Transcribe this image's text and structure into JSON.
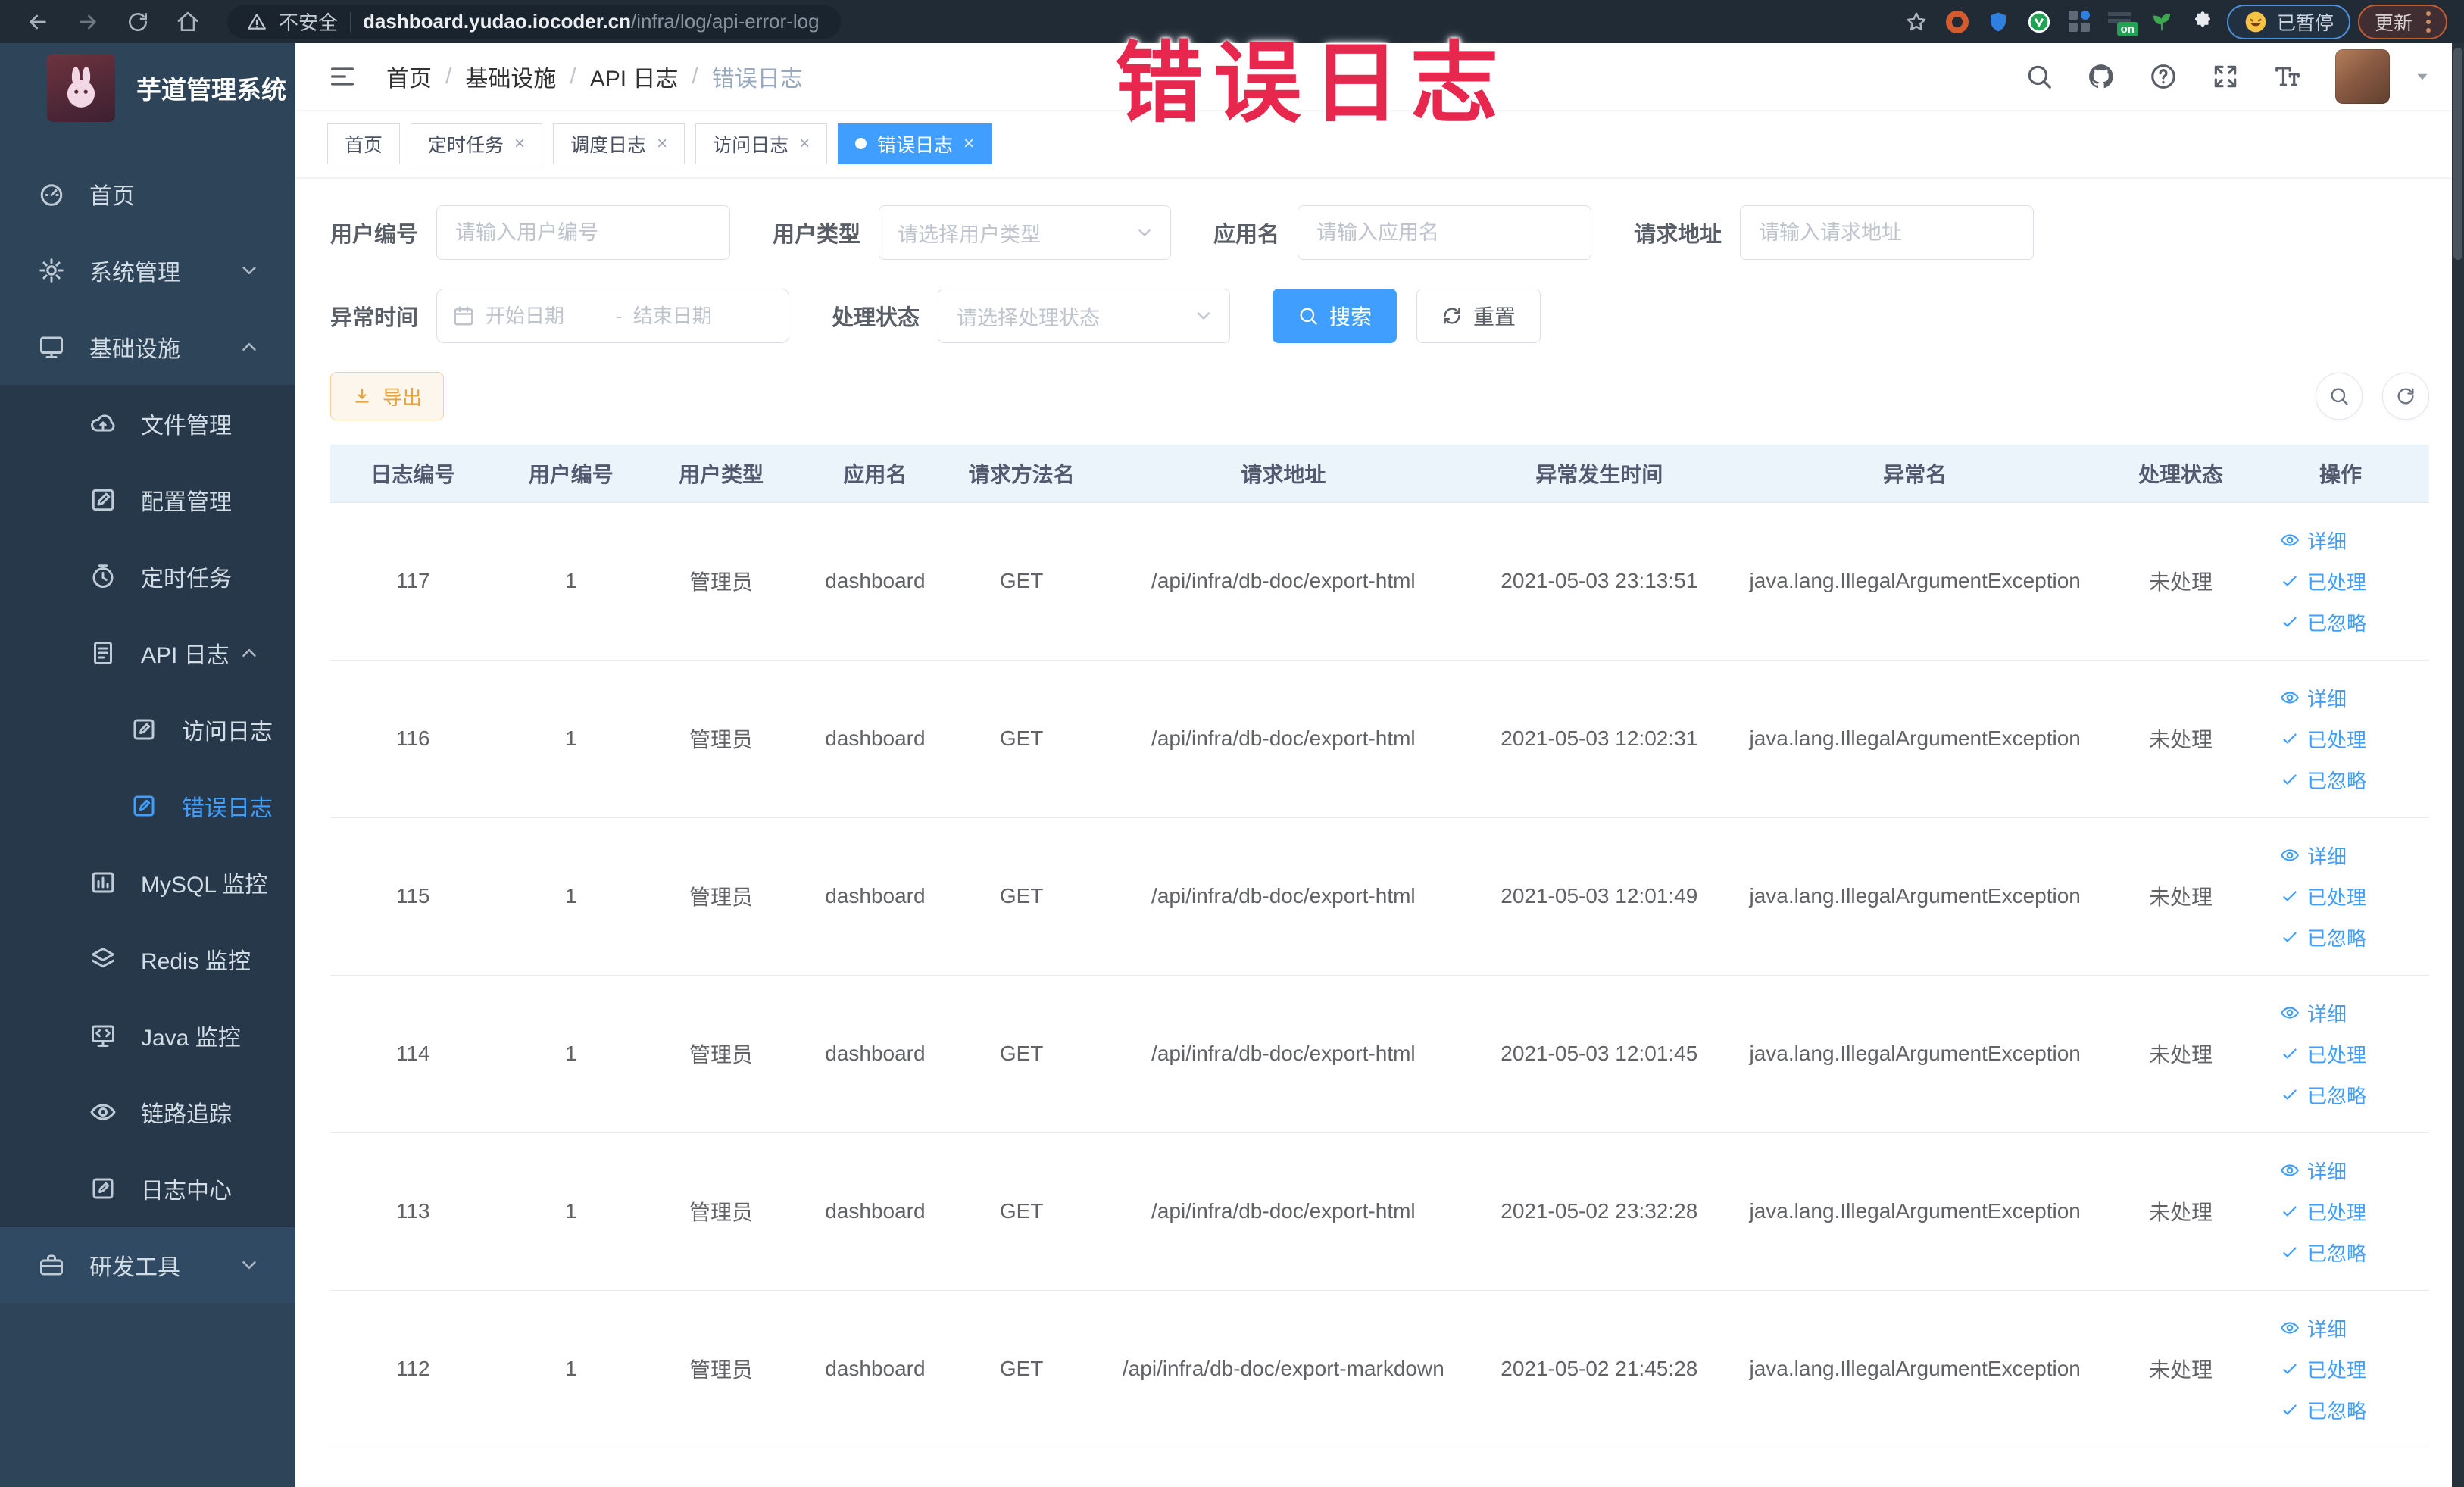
{
  "browser": {
    "security": "不安全",
    "host": "dashboard.yudao.iocoder.cn",
    "path": "/infra/log/api-error-log",
    "paused_badge": "已暂停",
    "update_button": "更新"
  },
  "annotation": {
    "text": "错误日志",
    "color": "#e7274e"
  },
  "sidebar": {
    "title": "芋道管理系统",
    "items": [
      {
        "label": "首页",
        "icon": "home",
        "level": 1
      },
      {
        "label": "系统管理",
        "icon": "gear",
        "level": 1,
        "arrow": "down"
      },
      {
        "label": "基础设施",
        "icon": "monitor",
        "level": 1,
        "arrow": "up"
      },
      {
        "label": "文件管理",
        "icon": "cloud",
        "level": 2,
        "sub": true
      },
      {
        "label": "配置管理",
        "icon": "edit",
        "level": 2,
        "sub": true
      },
      {
        "label": "定时任务",
        "icon": "timer",
        "level": 2,
        "sub": true
      },
      {
        "label": "API 日志",
        "icon": "doc",
        "level": 2,
        "sub": true,
        "arrow": "up"
      },
      {
        "label": "访问日志",
        "icon": "editsq",
        "level": 3,
        "sub": true
      },
      {
        "label": "错误日志",
        "icon": "editsq",
        "level": 3,
        "sub": true,
        "active": true
      },
      {
        "label": "MySQL 监控",
        "icon": "chart",
        "level": 2,
        "sub": true
      },
      {
        "label": "Redis 监控",
        "icon": "layers",
        "level": 2,
        "sub": true
      },
      {
        "label": "Java 监控",
        "icon": "java",
        "level": 2,
        "sub": true
      },
      {
        "label": "链路追踪",
        "icon": "eye",
        "level": 2,
        "sub": true
      },
      {
        "label": "日志中心",
        "icon": "editsq",
        "level": 2,
        "sub": true
      },
      {
        "label": "研发工具",
        "icon": "briefcase",
        "level": 1,
        "arrow": "down",
        "devtool": true
      }
    ]
  },
  "header": {
    "breadcrumb": [
      "首页",
      "基础设施",
      "API 日志",
      "错误日志"
    ],
    "separator": "/"
  },
  "tags": [
    {
      "label": "首页",
      "closable": false,
      "active": false
    },
    {
      "label": "定时任务",
      "closable": true,
      "active": false
    },
    {
      "label": "调度日志",
      "closable": true,
      "active": false
    },
    {
      "label": "访问日志",
      "closable": true,
      "active": false
    },
    {
      "label": "错误日志",
      "closable": true,
      "active": true
    }
  ],
  "filters": {
    "user_id": {
      "label": "用户编号",
      "placeholder": "请输入用户编号"
    },
    "user_type": {
      "label": "用户类型",
      "placeholder": "请选择用户类型"
    },
    "app_name": {
      "label": "应用名",
      "placeholder": "请输入应用名"
    },
    "request_url": {
      "label": "请求地址",
      "placeholder": "请输入请求地址"
    },
    "exception_time": {
      "label": "异常时间",
      "start_placeholder": "开始日期",
      "separator": "-",
      "end_placeholder": "结束日期"
    },
    "process_status": {
      "label": "处理状态",
      "placeholder": "请选择处理状态"
    },
    "search_label": "搜索",
    "reset_label": "重置"
  },
  "toolbar": {
    "export_label": "导出"
  },
  "table": {
    "columns": [
      "日志编号",
      "用户编号",
      "用户类型",
      "应用名",
      "请求方法名",
      "请求地址",
      "异常发生时间",
      "异常名",
      "处理状态",
      "操作"
    ],
    "rows": [
      [
        "117",
        "1",
        "管理员",
        "dashboard",
        "GET",
        "/api/infra/db-doc/export-html",
        "2021-05-03 23:13:51",
        "java.lang.IllegalArgumentException",
        "未处理"
      ],
      [
        "116",
        "1",
        "管理员",
        "dashboard",
        "GET",
        "/api/infra/db-doc/export-html",
        "2021-05-03 12:02:31",
        "java.lang.IllegalArgumentException",
        "未处理"
      ],
      [
        "115",
        "1",
        "管理员",
        "dashboard",
        "GET",
        "/api/infra/db-doc/export-html",
        "2021-05-03 12:01:49",
        "java.lang.IllegalArgumentException",
        "未处理"
      ],
      [
        "114",
        "1",
        "管理员",
        "dashboard",
        "GET",
        "/api/infra/db-doc/export-html",
        "2021-05-03 12:01:45",
        "java.lang.IllegalArgumentException",
        "未处理"
      ],
      [
        "113",
        "1",
        "管理员",
        "dashboard",
        "GET",
        "/api/infra/db-doc/export-html",
        "2021-05-02 23:32:28",
        "java.lang.IllegalArgumentException",
        "未处理"
      ],
      [
        "112",
        "1",
        "管理员",
        "dashboard",
        "GET",
        "/api/infra/db-doc/export-markdown",
        "2021-05-02 21:45:28",
        "java.lang.IllegalArgumentException",
        "未处理"
      ]
    ],
    "row_actions": [
      "详细",
      "已处理",
      "已忽略"
    ]
  },
  "colors": {
    "accent": "#409eff",
    "warning": "#e6a23c",
    "annotation": "#e7274e"
  }
}
